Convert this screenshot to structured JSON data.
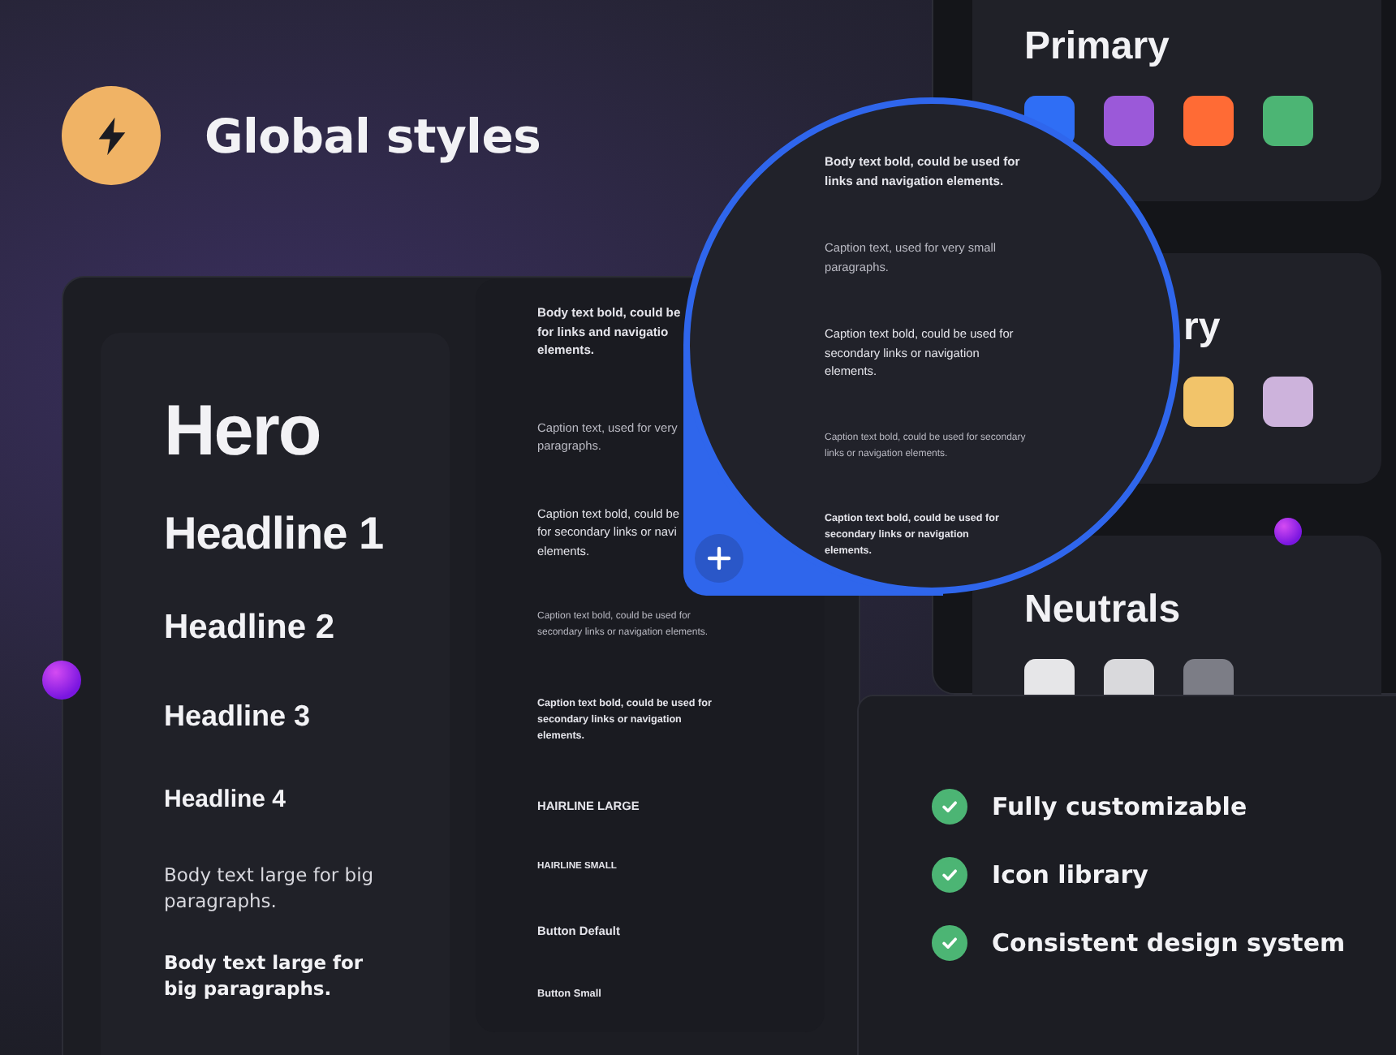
{
  "header": {
    "title": "Global styles"
  },
  "type_scale": [
    {
      "kind": "hero",
      "text": "Hero"
    },
    {
      "kind": "h1",
      "text": "Headline 1"
    },
    {
      "kind": "h2",
      "text": "Headline 2"
    },
    {
      "kind": "h3",
      "text": "Headline 3"
    },
    {
      "kind": "h4",
      "text": "Headline 4"
    },
    {
      "kind": "body",
      "text": "Body text large for big paragraphs."
    },
    {
      "kind": "body_bold",
      "text": "Body text large for big paragraphs."
    }
  ],
  "styles_list": [
    {
      "kind": "body_bold",
      "lines": [
        "Body text bold, could be",
        "for links and navigatio",
        "elements."
      ]
    },
    {
      "kind": "caption",
      "lines": [
        "Caption text, used for very",
        "paragraphs."
      ]
    },
    {
      "kind": "caption_bold",
      "lines": [
        "Caption text bold, could be",
        "for secondary links or navi",
        "elements."
      ]
    },
    {
      "kind": "caption_small",
      "lines": [
        "Caption text bold, could be used for",
        "secondary links or navigation elements."
      ]
    },
    {
      "kind": "caption_small_bold",
      "lines": [
        "Caption text bold, could be used for",
        "secondary links or navigation",
        "elements."
      ]
    },
    {
      "kind": "hairline_large",
      "lines": [
        "HAIRLINE LARGE"
      ]
    },
    {
      "kind": "hairline_small",
      "lines": [
        "HAIRLINE SMALL"
      ]
    },
    {
      "kind": "button_default",
      "lines": [
        "Button Default"
      ]
    },
    {
      "kind": "button_small",
      "lines": [
        "Button Small"
      ]
    }
  ],
  "magnifier": {
    "items": [
      {
        "kind": "body_bold",
        "text": "Body text bold, could be used for links and navigation elements."
      },
      {
        "kind": "caption",
        "text": "Caption text, used for very small paragraphs."
      },
      {
        "kind": "caption_bold",
        "text": "Caption text bold, could be used for secondary links or navigation elements."
      },
      {
        "kind": "caption_small",
        "text": "Caption text bold, could be used for secondary links or navigation elements."
      },
      {
        "kind": "caption_small_bold",
        "text": "Caption text bold, could be used for secondary links or navigation elements."
      }
    ]
  },
  "palettes": [
    {
      "title": "Primary",
      "kind": "full",
      "swatches": [
        {
          "color": "#2f6ef5"
        },
        {
          "color": "#9b59d9"
        },
        {
          "color": "#ff6b35"
        },
        {
          "color": "#4cb574"
        }
      ]
    },
    {
      "title": "ry",
      "kind": "covered",
      "swatches": [
        {
          "color": "#f2c46a"
        },
        {
          "color": "#cdb3dc"
        }
      ]
    },
    {
      "title": "Neutrals",
      "kind": "full",
      "swatches": [
        {
          "color": "#e6e6e8"
        },
        {
          "color": "#d9d9dc"
        },
        {
          "color": "#7c7d86"
        }
      ]
    }
  ],
  "features": [
    {
      "label": "Fully customizable",
      "checked": true
    },
    {
      "label": "Icon library",
      "checked": true
    },
    {
      "label": "Consistent design system",
      "checked": true
    }
  ]
}
